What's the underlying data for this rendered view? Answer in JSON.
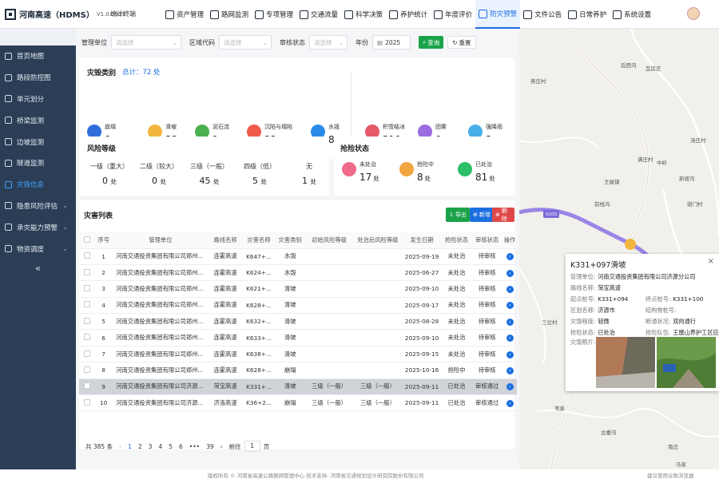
{
  "app": {
    "title": "河南高速（HDMS）",
    "version": "V1.0.0913",
    "terminal": "统计终端"
  },
  "nav": [
    {
      "label": "资产管理",
      "icon": "box-icon"
    },
    {
      "label": "路网监测",
      "icon": "road-icon"
    },
    {
      "label": "专项管理",
      "icon": "folder-icon"
    },
    {
      "label": "交通流量",
      "icon": "car-icon"
    },
    {
      "label": "科学决策",
      "icon": "chart-icon"
    },
    {
      "label": "养护统计",
      "icon": "stats-icon"
    },
    {
      "label": "年度评价",
      "icon": "calendar-icon"
    },
    {
      "label": "防灾预警",
      "icon": "shield-icon"
    },
    {
      "label": "文件公告",
      "icon": "file-icon"
    },
    {
      "label": "日常养护",
      "icon": "wrench-icon"
    },
    {
      "label": "系统设置",
      "icon": "gear-icon"
    }
  ],
  "nav_active": 7,
  "sidebar": {
    "items": [
      {
        "label": "首页地图",
        "icon": "home-icon"
      },
      {
        "label": "路段防控图",
        "icon": "route-icon"
      },
      {
        "label": "单元划分",
        "icon": "grid-icon"
      },
      {
        "label": "桥梁监测",
        "icon": "bridge-icon"
      },
      {
        "label": "边坡监测",
        "icon": "slope-icon"
      },
      {
        "label": "隧道监测",
        "icon": "tunnel-icon"
      },
      {
        "label": "灾毁信息",
        "icon": "alert-icon"
      },
      {
        "label": "隐患风险评估",
        "icon": "risk-icon"
      },
      {
        "label": "承灾能力预警",
        "icon": "warning-icon"
      },
      {
        "label": "物资调度",
        "icon": "package-icon"
      }
    ],
    "active": 6,
    "collapse": "«"
  },
  "filters": {
    "unit_label": "管理单位",
    "unit_placeholder": "请选择",
    "area_label": "区域代码",
    "area_placeholder": "请选择",
    "status_label": "审核状态",
    "status_placeholder": "请选择",
    "year_label": "年份",
    "year_value": "2025",
    "query": "查询",
    "reset": "重置"
  },
  "disaster": {
    "title": "灾毁类别",
    "total_label": "总计：",
    "total_value": "72 处",
    "unit": "处",
    "items": [
      {
        "name": "崩塌",
        "count": "8",
        "color": "#2f6fdc"
      },
      {
        "name": "滑坡",
        "count": "33",
        "color": "#f2b640"
      },
      {
        "name": "泥石流",
        "count": "1",
        "color": "#4caf50"
      },
      {
        "name": "沉陷与塌陷",
        "count": "22",
        "color": "#ef5a4a"
      },
      {
        "name": "水毁",
        "count": "8",
        "color": "#2b8be8"
      },
      {
        "name": "积雪结冰",
        "count": "310",
        "color": "#e55a6a"
      },
      {
        "name": "团雾",
        "count": "0",
        "color": "#9a6de0"
      },
      {
        "name": "强降雨",
        "count": "3",
        "color": "#4aaee8"
      }
    ]
  },
  "risk": {
    "title": "风险等级",
    "unit": "处",
    "items": [
      {
        "name": "一级（重大）",
        "count": "0"
      },
      {
        "name": "二级（较大）",
        "count": "0"
      },
      {
        "name": "三级（一般）",
        "count": "45"
      },
      {
        "name": "四级（低）",
        "count": "5"
      },
      {
        "name": "无",
        "count": "1"
      }
    ]
  },
  "rescue": {
    "title": "抢险状态",
    "unit": "处",
    "items": [
      {
        "name": "未处治",
        "count": "17",
        "color": "#f06b8a"
      },
      {
        "name": "抢险中",
        "count": "8",
        "color": "#f2a640"
      },
      {
        "name": "已处治",
        "count": "81",
        "color": "#2bbf6a"
      }
    ]
  },
  "list": {
    "title": "灾害列表",
    "export": "导出",
    "add": "新增",
    "delete": "删除",
    "columns": [
      "序号",
      "管理单位",
      "路线名称",
      "灾害名称",
      "灾害类别",
      "初始风险等级",
      "处治后风险等级",
      "发生日期",
      "抢险状态",
      "审核状态",
      "操作"
    ],
    "rows": [
      {
        "no": "1",
        "unit": "河南交通投资集团有限公司郑州...",
        "route": "连霍高速",
        "name": "K647+...",
        "type": "水毁",
        "init": "",
        "after": "",
        "date": "2025-09-19",
        "rescue": "未处治",
        "audit": "待审核"
      },
      {
        "no": "2",
        "unit": "河南交通投资集团有限公司郑州...",
        "route": "连霍高速",
        "name": "K624+...",
        "type": "水毁",
        "init": "",
        "after": "",
        "date": "2025-06-27",
        "rescue": "未处治",
        "audit": "待审核"
      },
      {
        "no": "3",
        "unit": "河南交通投资集团有限公司郑州...",
        "route": "连霍高速",
        "name": "K621+...",
        "type": "滑坡",
        "init": "",
        "after": "",
        "date": "2025-09-10",
        "rescue": "未处治",
        "audit": "待审核"
      },
      {
        "no": "4",
        "unit": "河南交通投资集团有限公司郑州...",
        "route": "连霍高速",
        "name": "K628+...",
        "type": "滑坡",
        "init": "",
        "after": "",
        "date": "2025-09-17",
        "rescue": "未处治",
        "audit": "待审核"
      },
      {
        "no": "5",
        "unit": "河南交通投资集团有限公司郑州...",
        "route": "连霍高速",
        "name": "K632+...",
        "type": "滑坡",
        "init": "",
        "after": "",
        "date": "2025-08-28",
        "rescue": "未处治",
        "audit": "待审核"
      },
      {
        "no": "6",
        "unit": "河南交通投资集团有限公司郑州...",
        "route": "连霍高速",
        "name": "K633+...",
        "type": "滑坡",
        "init": "",
        "after": "",
        "date": "2025-09-10",
        "rescue": "未处治",
        "audit": "待审核"
      },
      {
        "no": "7",
        "unit": "河南交通投资集团有限公司郑州...",
        "route": "连霍高速",
        "name": "K638+...",
        "type": "滑坡",
        "init": "",
        "after": "",
        "date": "2025-09-15",
        "rescue": "未处治",
        "audit": "待审核"
      },
      {
        "no": "8",
        "unit": "河南交通投资集团有限公司郑州...",
        "route": "连霍高速",
        "name": "K628+...",
        "type": "崩塌",
        "init": "",
        "after": "",
        "date": "2025-10-16",
        "rescue": "抢险中",
        "audit": "待审核"
      },
      {
        "no": "9",
        "unit": "河南交通投资集团有限公司济源...",
        "route": "菏宝高速",
        "name": "K331+...",
        "type": "滑坡",
        "init": "三级（一般）",
        "after": "三级（一般）",
        "date": "2025-09-11",
        "rescue": "已处治",
        "audit": "审核通过"
      },
      {
        "no": "10",
        "unit": "河南交通投资集团有限公司济源...",
        "route": "济洛高速",
        "name": "K36+2...",
        "type": "崩塌",
        "init": "三级（一般）",
        "after": "三级（一般）",
        "date": "2025-09-11",
        "rescue": "已处治",
        "audit": "审核通过"
      }
    ],
    "selected_row": 8
  },
  "pager": {
    "total": "共 385 条",
    "prev": "‹",
    "next": "›",
    "pages": [
      "1",
      "2",
      "3",
      "4",
      "5",
      "6",
      "•••",
      "39"
    ],
    "active": 0,
    "goto_label": "前往",
    "goto_value": "1",
    "goto_unit": "页"
  },
  "map": {
    "labels": [
      "后西沟",
      "瓦房庄",
      "燕庄村",
      "汤庄村",
      "满庄村",
      "王屋镇",
      "中岭",
      "新坡沟",
      "前栈沟",
      "驸门村",
      "G331",
      "三岔村",
      "刘村",
      "苇泉",
      "古垂沟",
      "马家",
      "南庄"
    ],
    "popup": {
      "title": "K331+097滑坡",
      "close": "×",
      "rows": [
        {
          "k": "管理单位:",
          "v": "河南交通投资集团有限公司济源分公司"
        },
        {
          "k": "路线名称:",
          "v": "菏宝高速"
        },
        {
          "k": "起点桩号:",
          "v": "K331+094",
          "k2": "终点桩号:",
          "v2": "K331+100"
        },
        {
          "k": "区划名称:",
          "v": "济源市",
          "k2": "结构物桩号:",
          "v2": ""
        },
        {
          "k": "灾毁程度:",
          "v": "轻微",
          "k2": "断通状况:",
          "v2": "双向通行"
        },
        {
          "k": "抢险状态:",
          "v": "已处治",
          "k2": "抢险队伍:",
          "v2": "王屋山养护工区应"
        }
      ],
      "photo_label": "灾毁照片:"
    }
  },
  "footer": {
    "text": "版权所有 © 河南省高速公路联网管理中心 技术支持: 河南省交通规划设计研究院股份有限公司",
    "right": "建议使用谷歌浏览器"
  }
}
